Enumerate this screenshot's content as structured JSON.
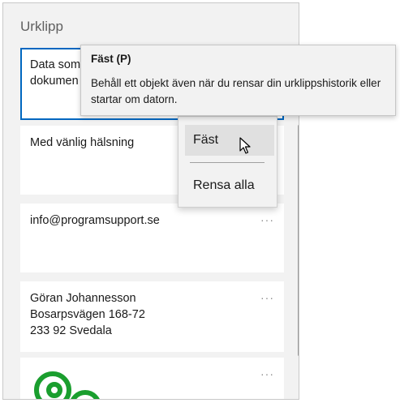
{
  "panel": {
    "title": "Urklipp"
  },
  "items": [
    {
      "lines": [
        "Data som",
        "dokumen"
      ]
    },
    {
      "lines": [
        "Med vänlig hälsning"
      ]
    },
    {
      "lines": [
        "info@programsupport.se"
      ],
      "more": "···"
    },
    {
      "lines": [
        "Göran Johannesson",
        "Bosarpsvägen 168-72",
        "233 92 Svedala"
      ],
      "more": "···"
    },
    {
      "image_icon": "green-at-logo-icon",
      "more": "···"
    }
  ],
  "tooltip": {
    "title": "Fäst (P)",
    "body": "Behåll ett objekt även när du rensar din urklippshistorik eller startar om datorn."
  },
  "context_menu": {
    "items": [
      {
        "label": "Fäst"
      },
      {
        "label": "Rensa alla"
      }
    ]
  },
  "colors": {
    "accent": "#0067c0",
    "logo_green": "#1a9e2e"
  }
}
